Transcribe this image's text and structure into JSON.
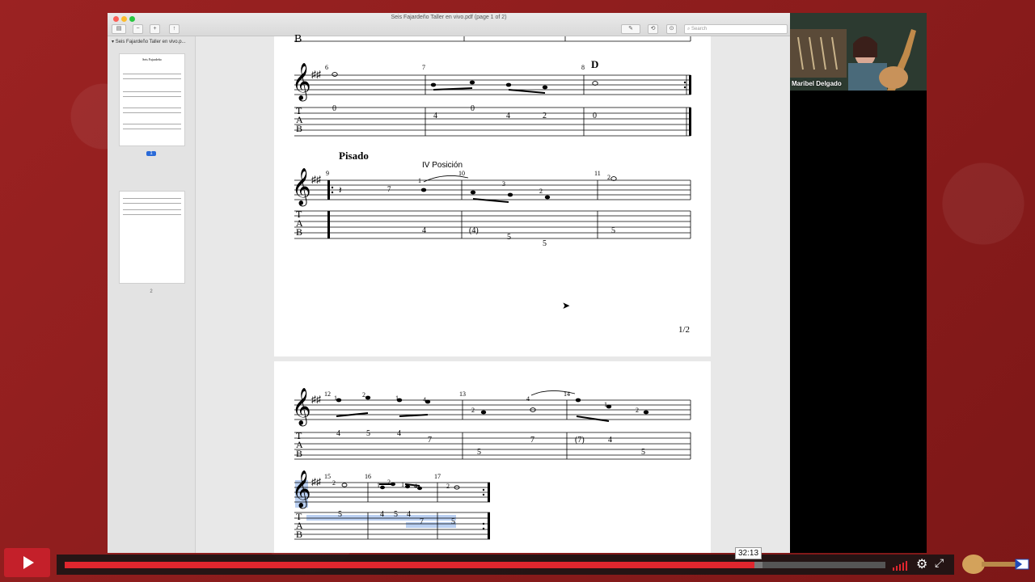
{
  "window": {
    "title": "Seis Fajardeño Taller en vivo.pdf (page 1 of 2)",
    "search_placeholder": "Search"
  },
  "sidebar": {
    "doc_name": "Seis Fajardeño Taller en vivo.p...",
    "thumb1_title": "Seis Fajardeño",
    "pages": [
      {
        "label": "1",
        "selected": true
      },
      {
        "label": "2",
        "selected": false
      }
    ]
  },
  "sheet": {
    "top_clef": "B",
    "system1": {
      "measures": [
        "6",
        "7",
        "8"
      ],
      "chord": "D",
      "tab_numbers": [
        "0",
        "4",
        "0",
        "4",
        "2",
        "0"
      ]
    },
    "section_title": "Pisado",
    "position_label": "IV Posición",
    "system2": {
      "measures": [
        "9",
        "10",
        "11"
      ],
      "fingerings": [
        "7",
        "1",
        "3",
        "2",
        "2"
      ],
      "tab_numbers": [
        "4",
        "(4)",
        "5",
        "5",
        "5"
      ]
    },
    "page_num": "1/2",
    "system3": {
      "measures": [
        "12",
        "13",
        "14"
      ],
      "fingerings": [
        "1",
        "2",
        "1",
        "4",
        "2",
        "4",
        "1",
        "2"
      ],
      "tab_numbers": [
        "4",
        "5",
        "4",
        "7",
        "5",
        "7",
        "(7)",
        "4",
        "5"
      ]
    },
    "system4": {
      "measures": [
        "15",
        "16",
        "17"
      ],
      "fingerings": [
        "2",
        "1",
        "2",
        "1",
        "4",
        "2"
      ],
      "tab_numbers": [
        "5",
        "4",
        "5",
        "4",
        "7",
        "5"
      ]
    },
    "tab_letters": [
      "T",
      "A",
      "B"
    ]
  },
  "zoom": {
    "participant_name": "Maribel Delgado"
  },
  "player": {
    "current_time": "32:13",
    "progress": 0.84,
    "buffered": 0.85
  },
  "colors": {
    "brand_red": "#c4202a",
    "progress_red": "#e0262e",
    "background": "#8f1d1d"
  }
}
